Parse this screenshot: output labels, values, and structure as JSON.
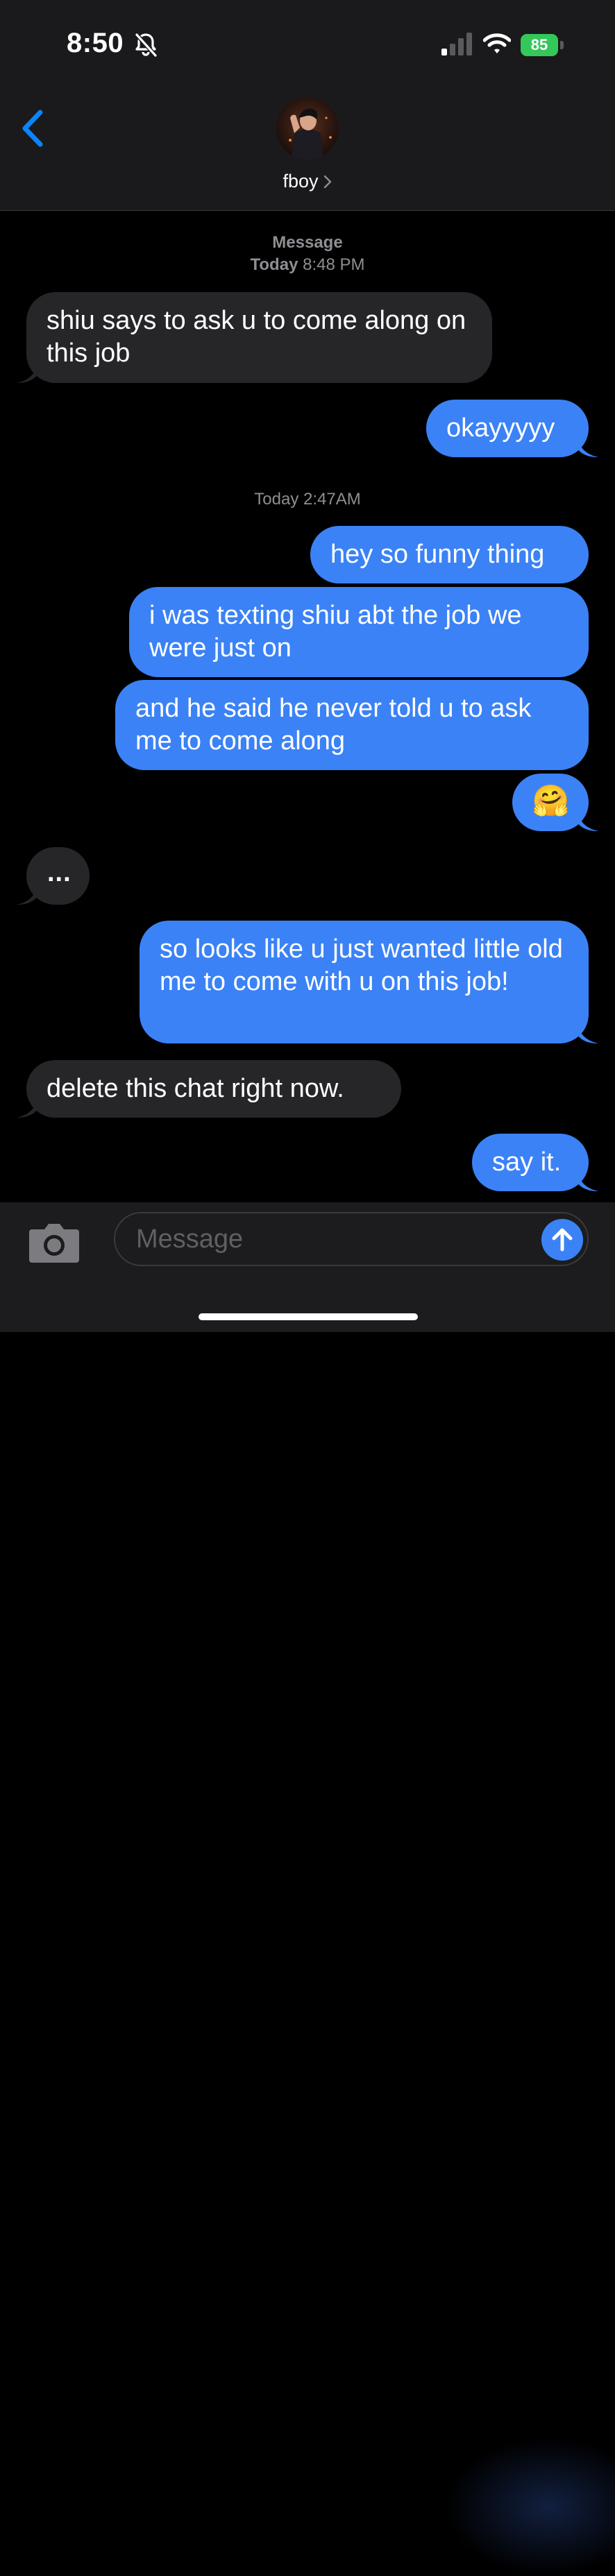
{
  "status_bar": {
    "time": "8:50",
    "battery": "85"
  },
  "header": {
    "contact_name": "fboy"
  },
  "timestamps": {
    "first_label": "Message",
    "first_day": "Today",
    "first_time": "8:48 PM",
    "second": "Today 2:47AM"
  },
  "messages": [
    {
      "direction": "incoming",
      "text": "shiu says to ask u to come along on this job"
    },
    {
      "direction": "outgoing",
      "text": "okayyyyy"
    },
    {
      "direction": "outgoing",
      "text": "hey so funny thing"
    },
    {
      "direction": "outgoing",
      "text": "i was texting shiu abt the job we were just on"
    },
    {
      "direction": "outgoing",
      "text": "and he said he never told u to ask me to come along"
    },
    {
      "direction": "outgoing",
      "text": "🤗"
    },
    {
      "direction": "incoming",
      "text": "..."
    },
    {
      "direction": "outgoing",
      "text": "so looks like u just wanted little old me to come with u on this job!"
    },
    {
      "direction": "incoming",
      "text": "delete this chat right now."
    },
    {
      "direction": "outgoing",
      "text": "say it."
    }
  ],
  "input": {
    "placeholder": "Message"
  },
  "colors": {
    "outgoing_bubble": "#3b82f6",
    "incoming_bubble": "#262628",
    "accent": "#0a84ff",
    "battery": "#34c759"
  }
}
